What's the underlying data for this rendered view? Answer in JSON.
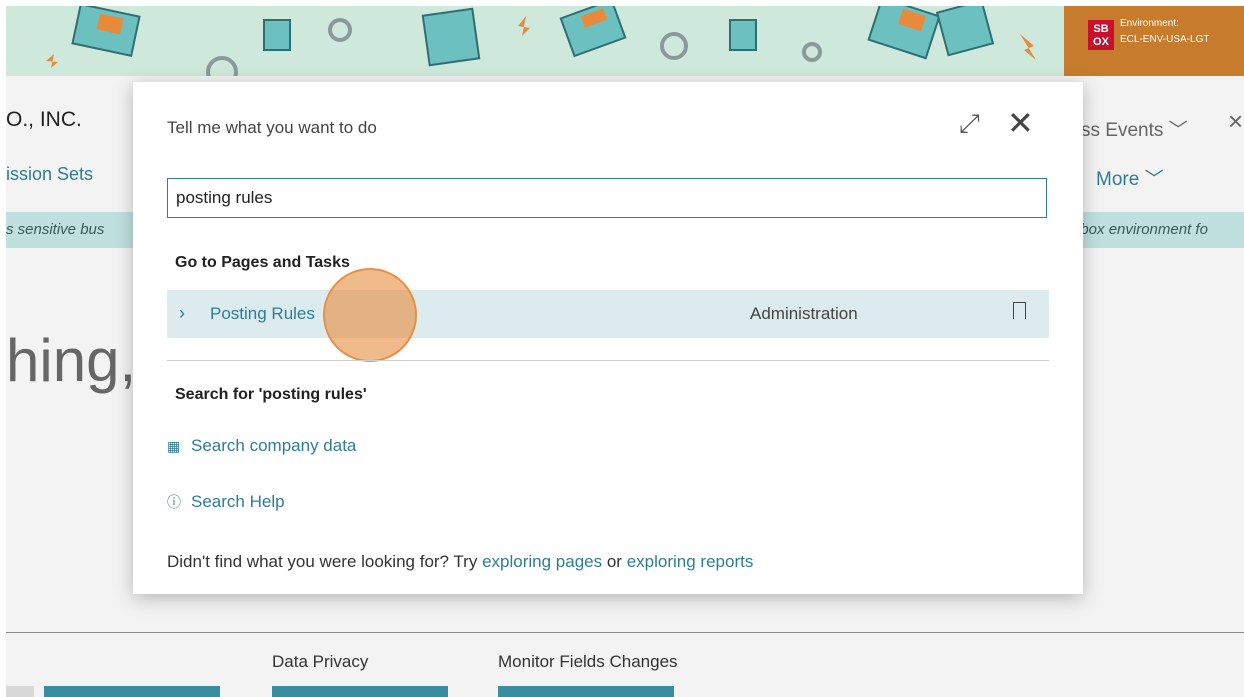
{
  "environment": {
    "badge": "SB OX",
    "label": "Environment:",
    "value": "ECL-ENV-USA-LGT"
  },
  "background": {
    "company": "O., INC.",
    "permission_sets": "ission Sets",
    "notice_left": "s sensitive bus",
    "notice_right": "dbox environment fo",
    "greeting": "hing,",
    "business_events": "ss Events",
    "more": "More",
    "cue_labels": [
      "Data Privacy",
      "Monitor Fields Changes"
    ]
  },
  "dialog": {
    "title": "Tell me what you want to do",
    "search_value": "posting rules",
    "pages_header": "Go to Pages and Tasks",
    "results": [
      {
        "name": "Posting Rules",
        "category": "Administration"
      }
    ],
    "search_for_header": "Search for 'posting rules'",
    "search_company": "Search company data",
    "search_help": "Search Help",
    "footer_prefix": "Didn't find what you were looking for? Try",
    "footer_link1": "exploring pages",
    "footer_or": "or",
    "footer_link2": "exploring reports"
  }
}
